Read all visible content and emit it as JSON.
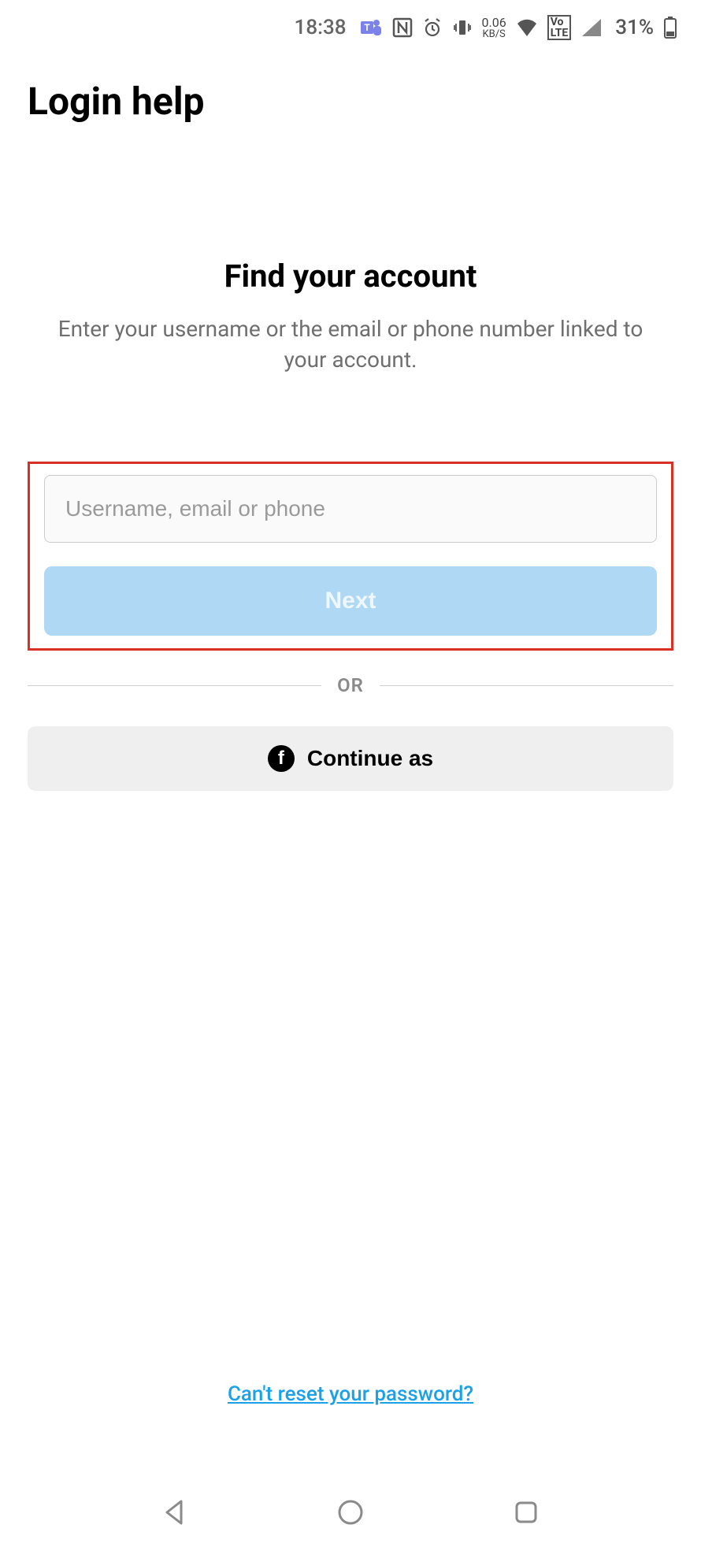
{
  "status": {
    "time": "18:38",
    "data_rate_top": "0.06",
    "data_rate_bottom": "KB/S",
    "volte": "VoLTE",
    "battery_pct": "31%"
  },
  "page_title": "Login help",
  "main": {
    "heading": "Find your account",
    "subtext": "Enter your username or the email or phone number linked to your account.",
    "input_placeholder": "Username, email or phone",
    "next_label": "Next",
    "or_label": "OR",
    "fb_label": "Continue as",
    "reset_link": "Can't reset your password?"
  }
}
